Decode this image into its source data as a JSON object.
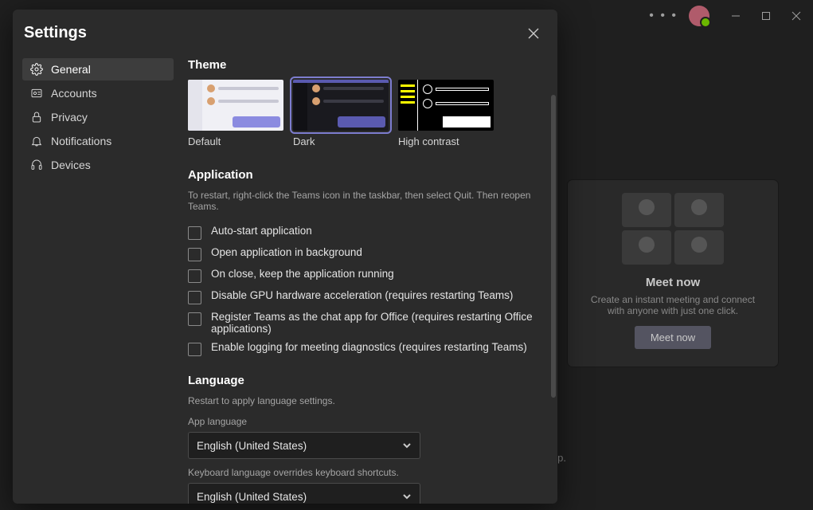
{
  "window": {
    "more_icon": "more",
    "minimize": "Minimize",
    "maximize": "Maximize",
    "close": "Close"
  },
  "background": {
    "meet_title": "Meet now",
    "meet_desc": "Create an instant meeting and connect with anyone with just one click.",
    "meet_btn": "Meet now",
    "footer_fragment": "app."
  },
  "settings": {
    "title": "Settings",
    "nav": {
      "general": "General",
      "accounts": "Accounts",
      "privacy": "Privacy",
      "notifications": "Notifications",
      "devices": "Devices"
    },
    "theme": {
      "heading": "Theme",
      "default": "Default",
      "dark": "Dark",
      "hc": "High contrast",
      "selected": "dark"
    },
    "application": {
      "heading": "Application",
      "note": "To restart, right-click the Teams icon in the taskbar, then select Quit. Then reopen Teams.",
      "opts": [
        "Auto-start application",
        "Open application in background",
        "On close, keep the application running",
        "Disable GPU hardware acceleration (requires restarting Teams)",
        "Register Teams as the chat app for Office (requires restarting Office applications)",
        "Enable logging for meeting diagnostics (requires restarting Teams)"
      ]
    },
    "language": {
      "heading": "Language",
      "note": "Restart to apply language settings.",
      "app_lang_label": "App language",
      "app_lang_value": "English (United States)",
      "kb_note": "Keyboard language overrides keyboard shortcuts.",
      "kb_value": "English (United States)"
    }
  }
}
